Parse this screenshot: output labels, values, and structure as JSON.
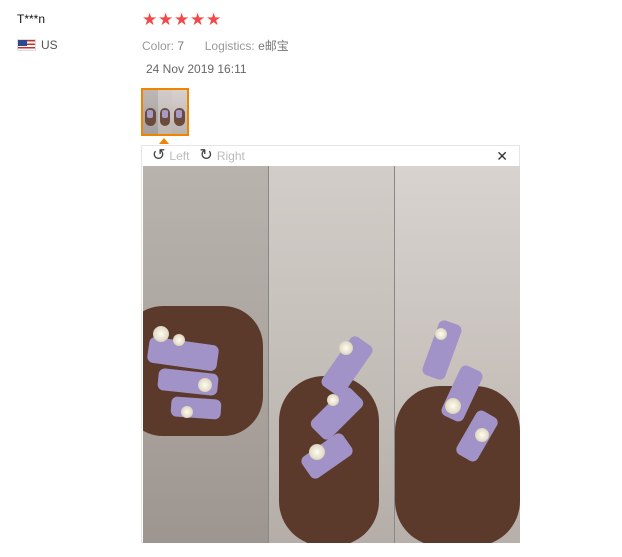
{
  "review": {
    "user_name": "T***n",
    "country": "US",
    "rating_stars": 5,
    "star_glyph": "★",
    "color_label": "Color:",
    "color_value": "7",
    "logistics_label": "Logistics:",
    "logistics_value": "e邮宝",
    "date": "24 Nov 2019 16:11"
  },
  "viewer": {
    "rotate_left_label": "Left",
    "rotate_right_label": "Right",
    "rotate_left_icon": "↺",
    "rotate_right_icon": "↻",
    "close_icon": "✕"
  },
  "colors": {
    "star": "#f14a4a",
    "thumb_border": "#f08300",
    "nail": "#a193c7",
    "skin": "#5b3a2b"
  }
}
